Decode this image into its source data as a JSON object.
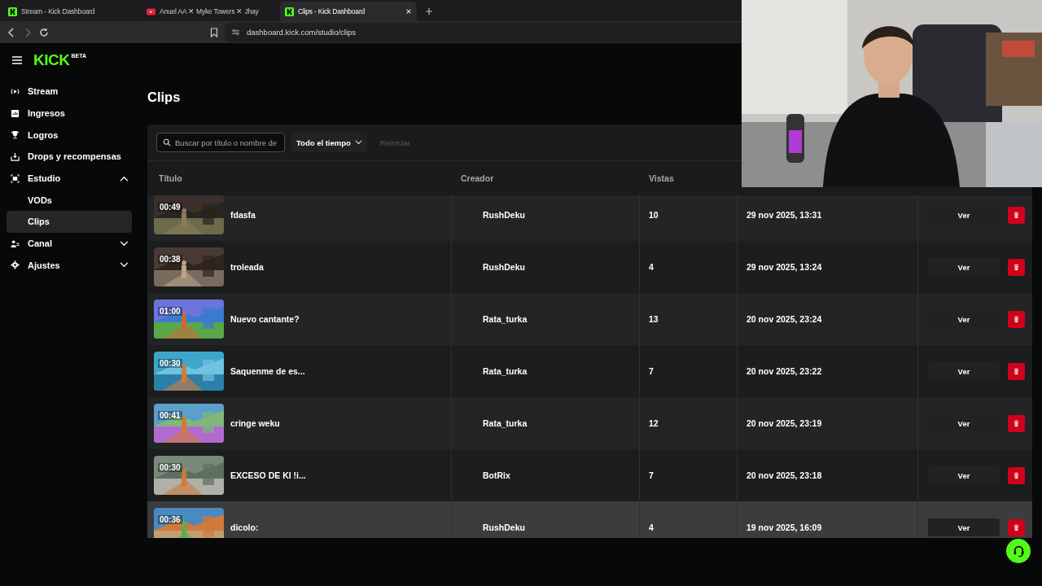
{
  "browser": {
    "tabs": [
      {
        "title": "Stream - Kick Dashboard",
        "kind": "kick",
        "selected": false
      },
      {
        "title": "Anuel AA ✕ Myke Towers ✕ Jhay",
        "kind": "video",
        "selected": false
      },
      {
        "title": "Clips - Kick Dashboard",
        "kind": "kick",
        "selected": true
      }
    ],
    "address": "dashboard.kick.com/studio/clips"
  },
  "logo": {
    "text": "KICK",
    "badge": "BETA"
  },
  "sidebar": {
    "items": [
      {
        "label": "Stream",
        "kind": "stream",
        "selected": false
      },
      {
        "label": "Ingresos",
        "kind": "chart",
        "selected": false
      },
      {
        "label": "Logros",
        "kind": "trophy",
        "selected": false
      },
      {
        "label": "Drops y recompensas",
        "kind": "drops",
        "selected": false
      },
      {
        "label": "Estudio",
        "kind": "studio",
        "selected": false,
        "expanded": true,
        "children": [
          {
            "label": "VODs",
            "selected": false
          },
          {
            "label": "Clips",
            "selected": true
          }
        ]
      },
      {
        "label": "Canal",
        "kind": "people",
        "selected": false,
        "expanded": false
      },
      {
        "label": "Ajustes",
        "kind": "gear",
        "selected": false,
        "expanded": false
      }
    ]
  },
  "page": {
    "title": "Clips"
  },
  "filters": {
    "search": {
      "placeholder": "Buscar por título o nombre de"
    },
    "period": "Todo el tiempo",
    "reset": {
      "label": "Reiniciar",
      "disabled": true
    }
  },
  "table": {
    "columns": [
      "Título",
      "Creador",
      "Vistas"
    ],
    "rows": [
      {
        "duration": "00:49",
        "title": "fdasfa",
        "creator": "RushDeku",
        "views": "10",
        "date": "29 nov 2025, 13:31",
        "action": "Ver",
        "highlighted": false
      },
      {
        "duration": "00:38",
        "title": "troleada",
        "creator": "RushDeku",
        "views": "4",
        "date": "29 nov 2025, 13:24",
        "action": "Ver",
        "highlighted": false
      },
      {
        "duration": "01:00",
        "title": "Nuevo cantante?",
        "creator": "Rata_turka",
        "views": "13",
        "date": "20 nov 2025, 23:24",
        "action": "Ver",
        "highlighted": false
      },
      {
        "duration": "00:30",
        "title": "Saquenme de es...",
        "creator": "Rata_turka",
        "views": "7",
        "date": "20 nov 2025, 23:22",
        "action": "Ver",
        "highlighted": false
      },
      {
        "duration": "00:41",
        "title": "cringe weku",
        "creator": "Rata_turka",
        "views": "12",
        "date": "20 nov 2025, 23:19",
        "action": "Ver",
        "highlighted": false
      },
      {
        "duration": "00:30",
        "title": "EXCESO DE KI !i...",
        "creator": "BotRix",
        "views": "7",
        "date": "20 nov 2025, 23:18",
        "action": "Ver",
        "highlighted": false
      },
      {
        "duration": "00:36",
        "title": "dicolo:",
        "creator": "RushDeku",
        "views": "4",
        "date": "19 nov 2025, 16:09",
        "action": "Ver",
        "highlighted": true
      }
    ]
  }
}
